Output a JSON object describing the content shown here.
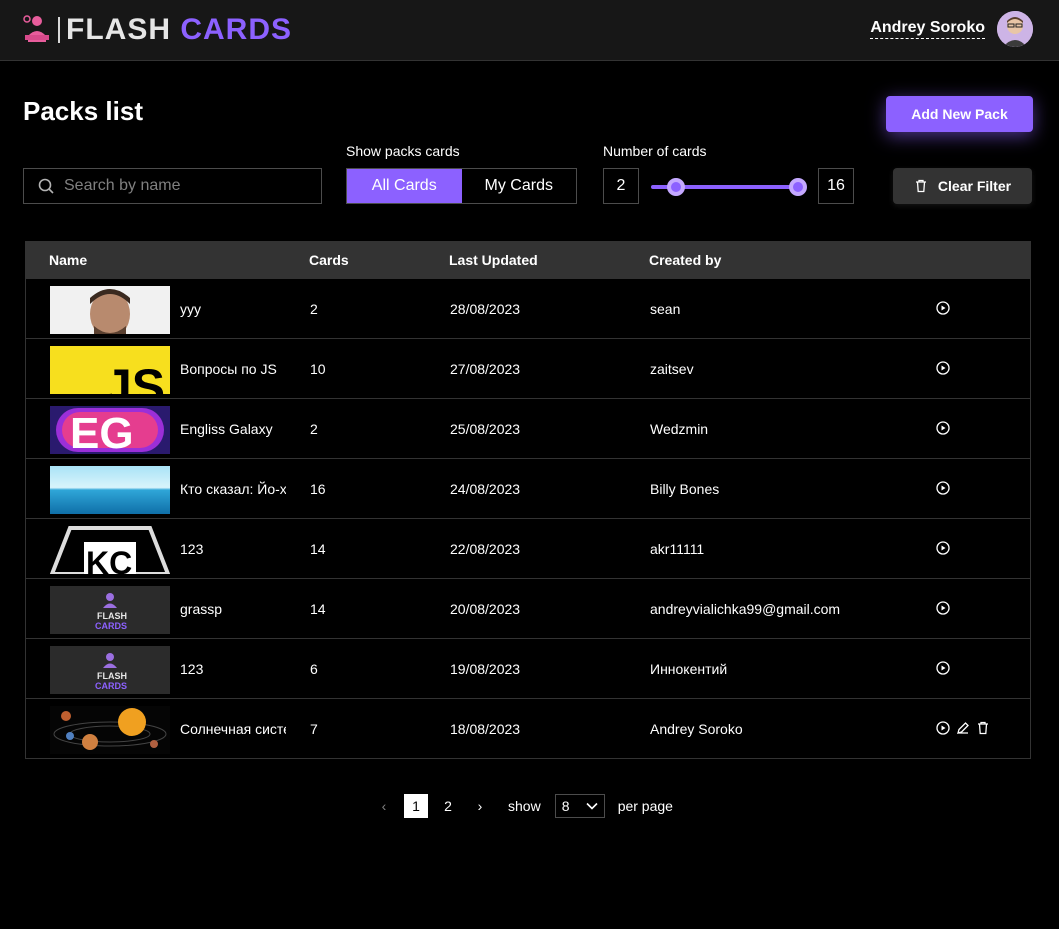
{
  "header": {
    "logo_flash": "FLASH",
    "logo_cards": "CARDS",
    "user_name": "Andrey Soroko"
  },
  "main": {
    "title": "Packs list",
    "add_button": "Add New Pack",
    "search_placeholder": "Search by name",
    "show_label": "Show packs cards",
    "toggle_all": "All Cards",
    "toggle_my": "My Cards",
    "number_label": "Number of cards",
    "range_min": "2",
    "range_max": "16",
    "clear_button": "Clear Filter"
  },
  "table": {
    "columns": [
      "Name",
      "Cards",
      "Last Updated",
      "Created by"
    ],
    "rows": [
      {
        "name": "yyy",
        "cards": "2",
        "updated": "28/08/2023",
        "author": "sean",
        "thumb": "portrait"
      },
      {
        "name": "Вопросы по JS",
        "cards": "10",
        "updated": "27/08/2023",
        "author": "zaitsev",
        "thumb": "js"
      },
      {
        "name": "Engliss Galaxy",
        "cards": "2",
        "updated": "25/08/2023",
        "author": "Wedzmin",
        "thumb": "eg"
      },
      {
        "name": "Кто сказал: Йо-х",
        "cards": "16",
        "updated": "24/08/2023",
        "author": "Billy Bones",
        "thumb": "sea"
      },
      {
        "name": "123",
        "cards": "14",
        "updated": "22/08/2023",
        "author": "akr11111",
        "thumb": "kc"
      },
      {
        "name": "grassp",
        "cards": "14",
        "updated": "20/08/2023",
        "author": "andreyvialichka99@gmail.com",
        "thumb": "flash"
      },
      {
        "name": "123",
        "cards": "6",
        "updated": "19/08/2023",
        "author": "Иннокентий",
        "thumb": "flash"
      },
      {
        "name": "Солнечная систе",
        "cards": "7",
        "updated": "18/08/2023",
        "author": "Andrey Soroko",
        "thumb": "solar",
        "owner": true
      }
    ]
  },
  "pagination": {
    "pages": [
      "1",
      "2"
    ],
    "current": "1",
    "show_label": "show",
    "per_page_value": "8",
    "per_page_label": "per page"
  },
  "colors": {
    "accent": "#8c61ff",
    "background": "#000000",
    "header": "#171717",
    "border": "#333333"
  }
}
